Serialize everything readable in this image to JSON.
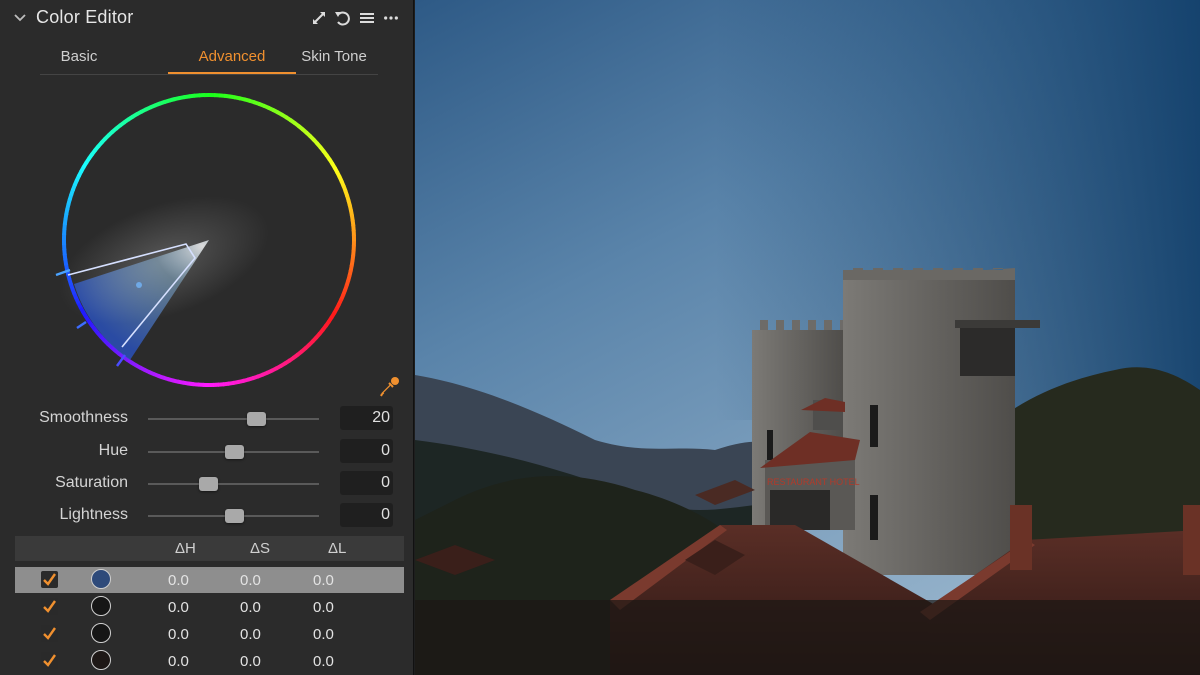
{
  "panel": {
    "title": "Color Editor",
    "header_icons": [
      "collapse-arrow-icon",
      "expand-arrows-icon",
      "reset-undo-icon",
      "list-menu-icon",
      "more-options-icon"
    ]
  },
  "tabs": [
    {
      "label": "Basic",
      "active": false
    },
    {
      "label": "Advanced",
      "active": true
    },
    {
      "label": "Skin Tone",
      "active": false
    }
  ],
  "accent_color": "#f0902f",
  "sliders": [
    {
      "label": "Smoothness",
      "value": "20",
      "position_fraction": 0.63
    },
    {
      "label": "Hue",
      "value": "0",
      "position_fraction": 0.5
    },
    {
      "label": "Saturation",
      "value": "0",
      "position_fraction": 0.35
    },
    {
      "label": "Lightness",
      "value": "0",
      "position_fraction": 0.5
    }
  ],
  "table": {
    "headers": [
      "ΔH",
      "ΔS",
      "ΔL"
    ],
    "rows": [
      {
        "checked": true,
        "swatch": "#2e4a7a",
        "selected": true,
        "dh": "0.0",
        "ds": "0.0",
        "dl": "0.0"
      },
      {
        "checked": true,
        "swatch": "#161616",
        "selected": false,
        "dh": "0.0",
        "ds": "0.0",
        "dl": "0.0"
      },
      {
        "checked": true,
        "swatch": "#161616",
        "selected": false,
        "dh": "0.0",
        "ds": "0.0",
        "dl": "0.0"
      },
      {
        "checked": true,
        "swatch": "#1e1816",
        "selected": false,
        "dh": "0.0",
        "ds": "0.0",
        "dl": "0.0"
      }
    ]
  },
  "photo": {
    "subject": "stone castle hotel with crenellated towers under a blue sky",
    "sign_text": "RESTAURANT HOTEL"
  }
}
